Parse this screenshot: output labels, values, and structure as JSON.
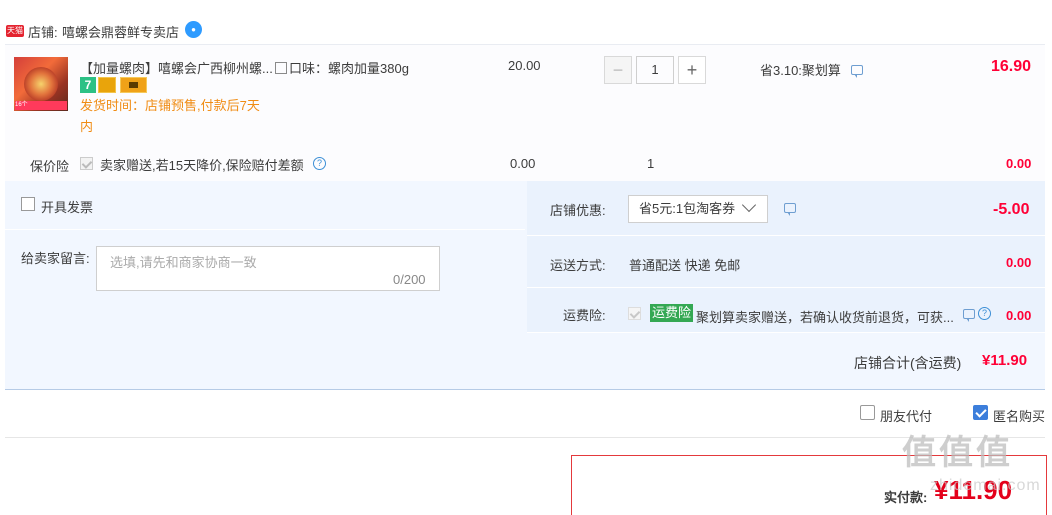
{
  "store": {
    "badge": "天猫",
    "label": "店铺:",
    "name": "嘻螺会鼎蓉鲜专卖店",
    "chat_icon": "chat-bubble-icon"
  },
  "item": {
    "thumb_tag": "16个",
    "title": "【加量螺肉】嘻螺会广西柳州螺...",
    "sku": "口味：螺肉加量380g",
    "badge_seven": "7",
    "ship_time": "发货时间：店铺预售,付款后7天内",
    "unit_price": "20.00",
    "quantity": "1",
    "minus": "−",
    "plus": "+",
    "saving": "省3.10:聚划算",
    "total": "16.90"
  },
  "insurance": {
    "label": "保价险",
    "text": "卖家赠送,若15天降价,保险赔付差额",
    "help": "?",
    "price": "0.00",
    "qty": "1",
    "total": "0.00"
  },
  "invoice": {
    "label": "开具发票"
  },
  "message": {
    "label": "给卖家留言:",
    "placeholder": "选填,请先和商家协商一致",
    "counter": "0/200"
  },
  "discount": {
    "label": "店铺优惠:",
    "selected": "省5元:1包淘客券",
    "amount": "-5.00"
  },
  "shipping": {
    "label": "运送方式:",
    "method": "普通配送 快递 免邮",
    "amount": "0.00"
  },
  "freight_insurance": {
    "label": "运费险:",
    "tag": "运费险",
    "text": "聚划算卖家赠送，若确认收货前退货，可获...",
    "help": "?",
    "amount": "0.00"
  },
  "store_total": {
    "label": "店铺合计(含运费)",
    "value": "¥11.90"
  },
  "options": {
    "friend_pay": "朋友代付",
    "anonymous": "匿名购买"
  },
  "payment": {
    "label": "实付款:",
    "value": "¥11.90"
  },
  "watermark": {
    "main": "值值值",
    "sub": "zhidemai.com"
  },
  "colors": {
    "price_red": "#ff0036",
    "panel_blue": "#f2f7ff",
    "accent_blue": "#3c7edb",
    "freight_green": "#34a853",
    "ship_orange": "#f08c14"
  }
}
